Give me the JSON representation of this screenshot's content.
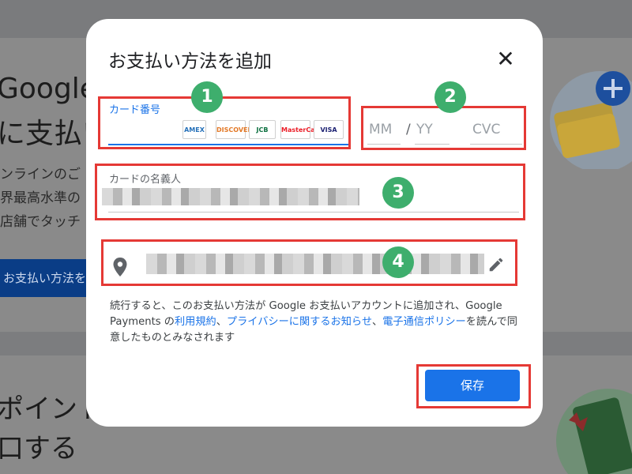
{
  "background": {
    "title_line1": "Google",
    "title_line2": "に支払い",
    "body_lines": [
      "ンラインのご",
      "界最高水準の",
      "店舗でタッチ"
    ],
    "button_label": "お支払い方法を",
    "lower_line1": "ポイント",
    "lower_line2": "口する"
  },
  "modal": {
    "title": "お支払い方法を追加",
    "close_icon": "close-icon",
    "card_number_label": "カード番号",
    "card_logos": [
      "AMEX",
      "DISCOVER",
      "JCB",
      "MasterCard",
      "VISA"
    ],
    "expiry_month_placeholder": "MM",
    "expiry_separator": "/",
    "expiry_year_placeholder": "YY",
    "cvc_placeholder": "CVC",
    "cardholder_label": "カードの名義人",
    "location_icon": "location-pin-icon",
    "edit_icon": "pencil-edit-icon",
    "legal": {
      "part1": "続行すると、このお支払い方法が Google お支払いアカウントに追加され、Google Payments の",
      "link1": "利用規約",
      "part2": "、",
      "link2": "プライバシーに関するお知らせ",
      "part3": "、",
      "link3": "電子通信ポリシー",
      "part4": "を読んで同意したものとみなされます"
    },
    "save_label": "保存"
  },
  "annotations": {
    "badges": [
      "1",
      "2",
      "3",
      "4"
    ],
    "highlight_color": "#e53935",
    "badge_color": "#3eae6d"
  }
}
